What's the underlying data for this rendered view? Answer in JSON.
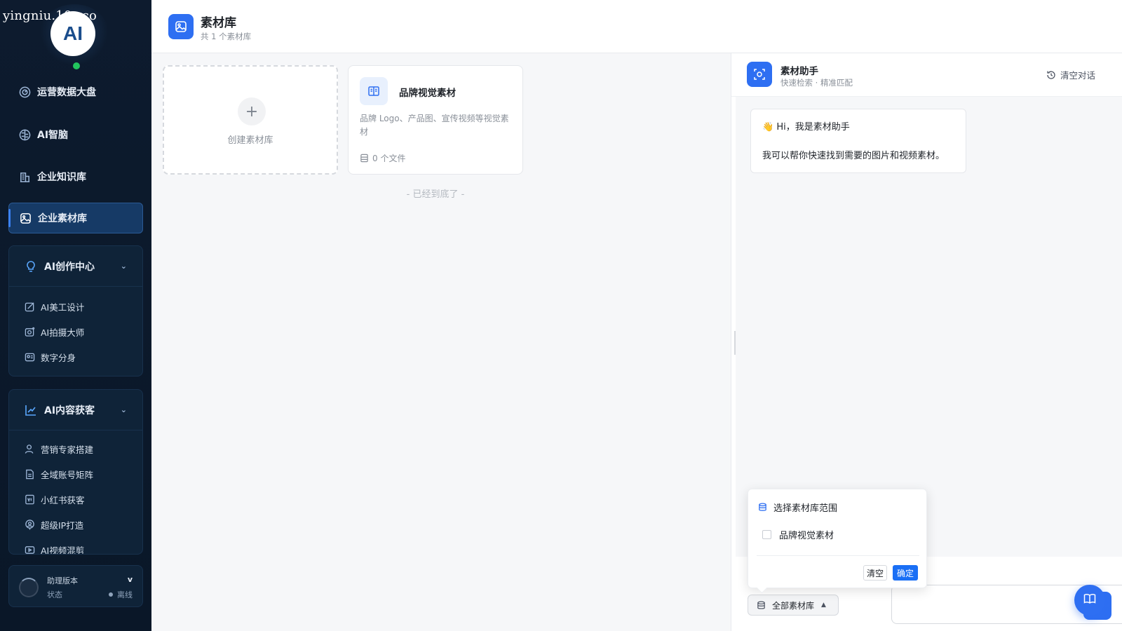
{
  "watermark": "yingniu.10v.co",
  "brand": {
    "logo_text": "AI"
  },
  "sidebar": {
    "items": [
      {
        "label": "运营数据大盘",
        "icon": "dashboard-icon"
      },
      {
        "label": "AI智脑",
        "icon": "brain-icon"
      },
      {
        "label": "企业知识库",
        "icon": "building-icon"
      },
      {
        "label": "企业素材库",
        "icon": "image-icon",
        "active": true
      }
    ],
    "groups": [
      {
        "label": "AI创作中心",
        "icon": "bulb-icon",
        "expanded": true,
        "items": [
          {
            "label": "AI美工设计",
            "icon": "design-icon"
          },
          {
            "label": "AI拍摄大师",
            "icon": "camera-icon"
          },
          {
            "label": "数字分身",
            "icon": "avatar-icon"
          }
        ]
      },
      {
        "label": "AI内容获客",
        "icon": "trend-icon",
        "expanded": true,
        "items": [
          {
            "label": "营销专家搭建",
            "icon": "user-icon"
          },
          {
            "label": "全域账号矩阵",
            "icon": "doc-icon"
          },
          {
            "label": "小红书获客",
            "icon": "note-icon"
          },
          {
            "label": "超级IP打造",
            "icon": "ip-icon"
          },
          {
            "label": "AI视频混剪",
            "icon": "video-icon"
          }
        ]
      }
    ],
    "version": {
      "label": "助理版本",
      "value": "v",
      "state_label": "状态",
      "state_value": "离线"
    }
  },
  "header": {
    "title": "素材库",
    "subtitle": "共 1 个素材库"
  },
  "main": {
    "create_label": "创建素材库",
    "library": {
      "title": "品牌视觉素材",
      "description": "品牌 Logo、产品图、宣传视频等视觉素材",
      "count": "0 个文件"
    },
    "end_text": "- 已经到底了 -"
  },
  "assistant": {
    "title": "素材助手",
    "subtitle": "快速检索 · 精准匹配",
    "clear_label": "清空对话",
    "greeting_emoji": "👋",
    "greeting": "Hi，我是素材助手",
    "message": "我可以帮你快速找到需要的图片和视频素材。",
    "scope_button": "全部素材库",
    "popover": {
      "title": "选择素材库范围",
      "option": "品牌视觉素材",
      "clear": "清空",
      "confirm": "确定"
    }
  },
  "colors": {
    "sidebar_bg": "#0d1b2e",
    "accent": "#2e6ff2",
    "online": "#22c55e"
  }
}
